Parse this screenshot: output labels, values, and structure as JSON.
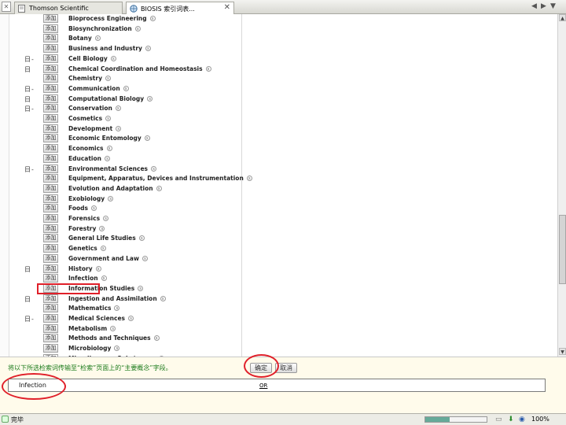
{
  "tabs": [
    {
      "label": "Thomson Scientific",
      "active": false
    },
    {
      "label": "BIOSIS 索引词表...",
      "active": true
    }
  ],
  "tab_close_glyph": "✕",
  "tab_nav": [
    "◀",
    "▶",
    "▼",
    "◀",
    "▶"
  ],
  "add_label": "添加",
  "terms": [
    {
      "label": "Bioprocess Engineering",
      "expander": ""
    },
    {
      "label": "Biosynchronization",
      "expander": ""
    },
    {
      "label": "Botany",
      "expander": ""
    },
    {
      "label": "Business and Industry",
      "expander": ""
    },
    {
      "label": "Cell Biology",
      "expander": "日-"
    },
    {
      "label": "Chemical Coordination and Homeostasis",
      "expander": "日"
    },
    {
      "label": "Chemistry",
      "expander": ""
    },
    {
      "label": "Communication",
      "expander": "日-"
    },
    {
      "label": "Computational Biology",
      "expander": "日"
    },
    {
      "label": "Conservation",
      "expander": "日-"
    },
    {
      "label": "Cosmetics",
      "expander": ""
    },
    {
      "label": "Development",
      "expander": ""
    },
    {
      "label": "Economic Entomology",
      "expander": ""
    },
    {
      "label": "Economics",
      "expander": ""
    },
    {
      "label": "Education",
      "expander": ""
    },
    {
      "label": "Environmental Sciences",
      "expander": "日-"
    },
    {
      "label": "Equipment, Apparatus, Devices and Instrumentation",
      "expander": ""
    },
    {
      "label": "Evolution and Adaptation",
      "expander": ""
    },
    {
      "label": "Exobiology",
      "expander": ""
    },
    {
      "label": "Foods",
      "expander": ""
    },
    {
      "label": "Forensics",
      "expander": ""
    },
    {
      "label": "Forestry",
      "expander": ""
    },
    {
      "label": "General Life Studies",
      "expander": ""
    },
    {
      "label": "Genetics",
      "expander": ""
    },
    {
      "label": "Government and Law",
      "expander": ""
    },
    {
      "label": "History",
      "expander": "日"
    },
    {
      "label": "Infection",
      "expander": ""
    },
    {
      "label": "Information Studies",
      "expander": ""
    },
    {
      "label": "Ingestion and Assimilation",
      "expander": "日"
    },
    {
      "label": "Mathematics",
      "expander": ""
    },
    {
      "label": "Medical Sciences",
      "expander": "日-"
    },
    {
      "label": "Metabolism",
      "expander": ""
    },
    {
      "label": "Methods and Techniques",
      "expander": ""
    },
    {
      "label": "Microbiology",
      "expander": ""
    },
    {
      "label": "Miscellaneous Substances",
      "expander": ""
    }
  ],
  "scope_glyph": "s",
  "bottom": {
    "instruction": "将以下所选检索词传输至“检索”页面上的“主要概念”字段。",
    "ok_label": "确定",
    "cancel_label": "取消",
    "topic_value": "Infection",
    "operator": "OR"
  },
  "status": {
    "text": "完毕",
    "zoom": "100%",
    "progress_percent": 40
  },
  "colors": {
    "highlight": "#e0202a",
    "instruction": "#1a7a1a",
    "panel_bg": "#fffbeb"
  }
}
